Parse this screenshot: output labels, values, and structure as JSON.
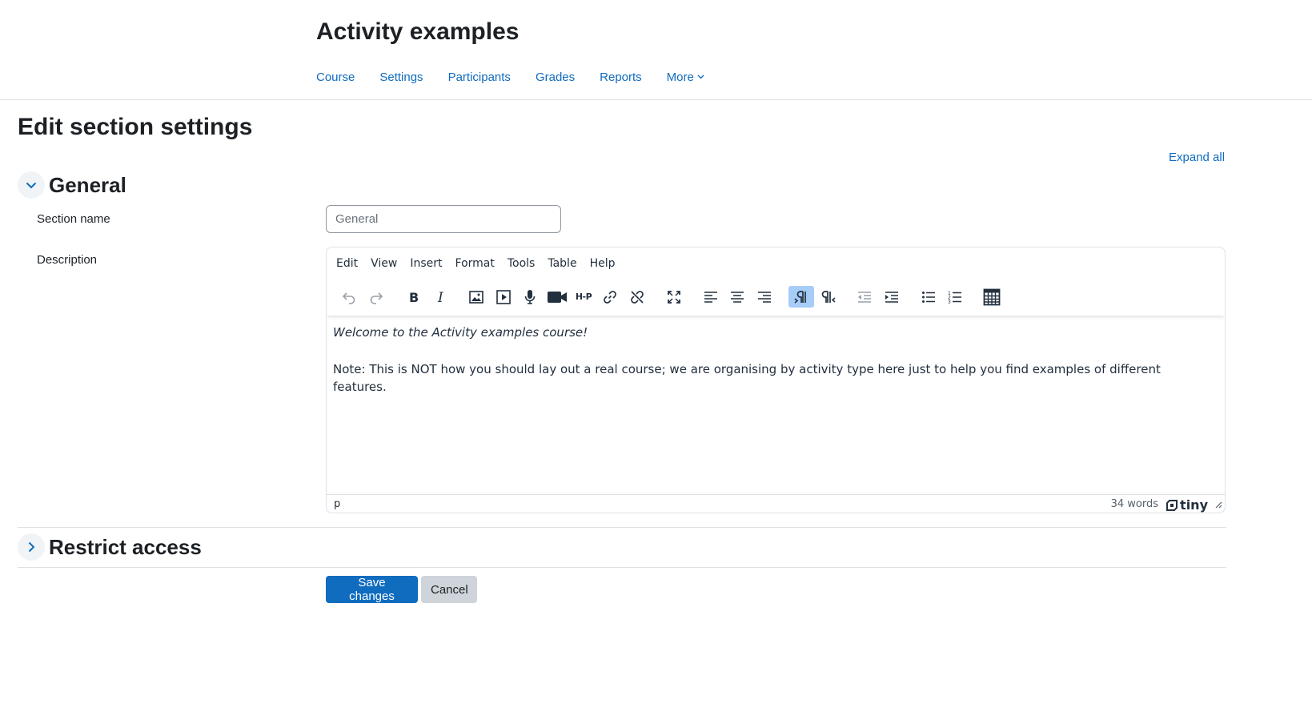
{
  "course": {
    "title": "Activity examples",
    "nav": [
      {
        "label": "Course"
      },
      {
        "label": "Settings"
      },
      {
        "label": "Participants"
      },
      {
        "label": "Grades"
      },
      {
        "label": "Reports"
      },
      {
        "label": "More"
      }
    ]
  },
  "page": {
    "title": "Edit section settings",
    "expand_all": "Expand all"
  },
  "general": {
    "heading": "General",
    "section_name_label": "Section name",
    "section_name_placeholder": "General",
    "section_name_value": "",
    "description_label": "Description"
  },
  "editor": {
    "menu": [
      "Edit",
      "View",
      "Insert",
      "Format",
      "Tools",
      "Table",
      "Help"
    ],
    "toolbar_icons": [
      "undo-icon",
      "redo-icon",
      "bold-icon",
      "italic-icon",
      "image-icon",
      "media-icon",
      "record-audio-icon",
      "record-video-icon",
      "h5p-icon",
      "link-icon",
      "unlink-icon",
      "fullscreen-icon",
      "align-left-icon",
      "align-center-icon",
      "align-right-icon",
      "ltr-icon",
      "rtl-icon",
      "outdent-icon",
      "indent-icon",
      "bullet-list-icon",
      "numbered-list-icon",
      "calculator-icon"
    ],
    "h5p_label": "H-P",
    "content": {
      "paragraph1": "Welcome to the Activity examples course!",
      "paragraph2": "Note: This is NOT how you should lay out a real course; we are organising by activity type here just to help you find examples of different features."
    },
    "status": {
      "path": "p",
      "word_count": "34 words",
      "brand": "tiny"
    }
  },
  "restrict": {
    "heading": "Restrict access"
  },
  "actions": {
    "save": "Save changes",
    "cancel": "Cancel"
  },
  "colors": {
    "link": "#0f6cbf",
    "primary": "#0f6cbf",
    "secondary": "#ced4da",
    "active_toolbar": "#a6ccf7"
  }
}
